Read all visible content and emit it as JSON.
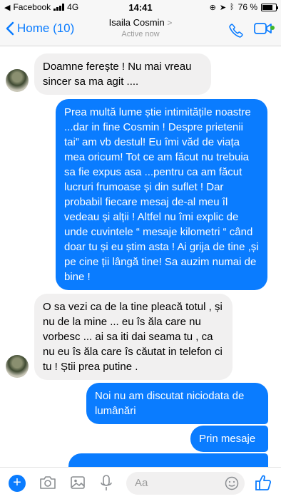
{
  "status_bar": {
    "app_back": "Facebook",
    "network": "4G",
    "time": "14:41",
    "battery": "76 %",
    "battery_level": 0.76
  },
  "header": {
    "back_label": "Home (10)",
    "contact_name": "Isaila Cosmin",
    "contact_status": "Active now"
  },
  "messages": [
    {
      "side": "in",
      "text": "Doamne ferește ! Nu mai vreau sincer sa ma agit ...."
    },
    {
      "side": "out",
      "text": "Prea multă lume știe intimitățile noastre ...dar in fine Cosmin ! Despre prietenii tai” am vb destul! Eu îmi văd de viața mea oricum! Tot ce am făcut nu trebuia sa fie expus asa ...pentru ca am făcut lucruri frumoase și din suflet ! Dar probabil fiecare mesaj de-al meu îl vedeau și alții ! Altfel nu îmi explic de unde cuvintele “ mesaje kilometri “ când doar tu și eu știm asta ! Ai grija de tine ,și pe cine ții lângă tine! Sa auzim numai de bine !"
    },
    {
      "side": "in",
      "text": "O sa vezi ca de la tine pleacă totul , și nu de la mine ... eu îs ăla care nu vorbesc ... ai sa iti dai seama tu , ca nu eu îs ăla care îs căutat in telefon ci tu ! Știi prea putine ."
    },
    {
      "side": "out",
      "text": "Noi nu am discutat niciodata de lumânări"
    },
    {
      "side": "out",
      "text": "Prin mesaje"
    }
  ],
  "composer": {
    "placeholder": "Aa"
  },
  "icons": {
    "accent": "#0a7cff",
    "incoming_bubble": "#f1f0f0",
    "online": "#42b72a"
  }
}
